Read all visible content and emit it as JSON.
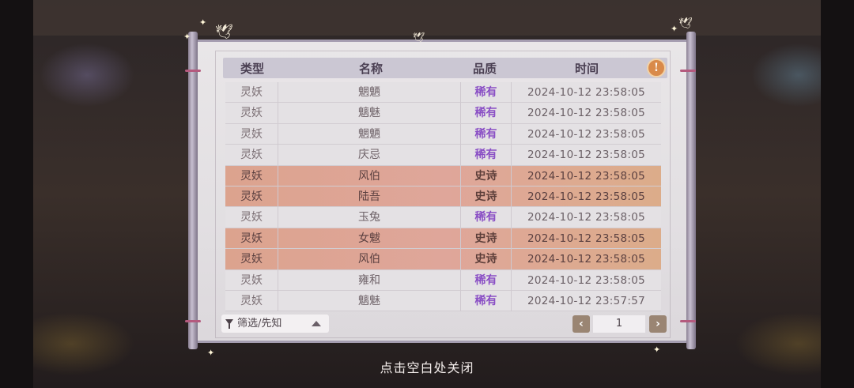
{
  "table": {
    "headers": [
      "类型",
      "名称",
      "品质",
      "时间"
    ],
    "rows": [
      {
        "type": "灵妖",
        "name": "魍魉",
        "quality": "稀有",
        "time": "2024-10-12  23:58:05",
        "epic": false
      },
      {
        "type": "灵妖",
        "name": "魑魅",
        "quality": "稀有",
        "time": "2024-10-12  23:58:05",
        "epic": false
      },
      {
        "type": "灵妖",
        "name": "魍魉",
        "quality": "稀有",
        "time": "2024-10-12  23:58:05",
        "epic": false
      },
      {
        "type": "灵妖",
        "name": "庆忌",
        "quality": "稀有",
        "time": "2024-10-12  23:58:05",
        "epic": false
      },
      {
        "type": "灵妖",
        "name": "风伯",
        "quality": "史诗",
        "time": "2024-10-12  23:58:05",
        "epic": true
      },
      {
        "type": "灵妖",
        "name": "陆吾",
        "quality": "史诗",
        "time": "2024-10-12  23:58:05",
        "epic": true
      },
      {
        "type": "灵妖",
        "name": "玉兔",
        "quality": "稀有",
        "time": "2024-10-12  23:58:05",
        "epic": false
      },
      {
        "type": "灵妖",
        "name": "女魃",
        "quality": "史诗",
        "time": "2024-10-12  23:58:05",
        "epic": true
      },
      {
        "type": "灵妖",
        "name": "风伯",
        "quality": "史诗",
        "time": "2024-10-12  23:58:05",
        "epic": true
      },
      {
        "type": "灵妖",
        "name": "雍和",
        "quality": "稀有",
        "time": "2024-10-12  23:58:05",
        "epic": false
      },
      {
        "type": "灵妖",
        "name": "魑魅",
        "quality": "稀有",
        "time": "2024-10-12  23:57:57",
        "epic": false
      }
    ]
  },
  "info_button": {
    "icon": "exclamation-icon",
    "label": "!"
  },
  "filter": {
    "label": "筛选/先知",
    "icon": "funnel-icon",
    "arrow_icon": "triangle-up-icon"
  },
  "pager": {
    "prev": "‹",
    "next": "›",
    "current_page": "1"
  },
  "close_hint": "点击空白处关闭",
  "colors": {
    "rare": "#8a4fc5",
    "epic_row": "#dca38e",
    "accent": "#d98a4a"
  }
}
